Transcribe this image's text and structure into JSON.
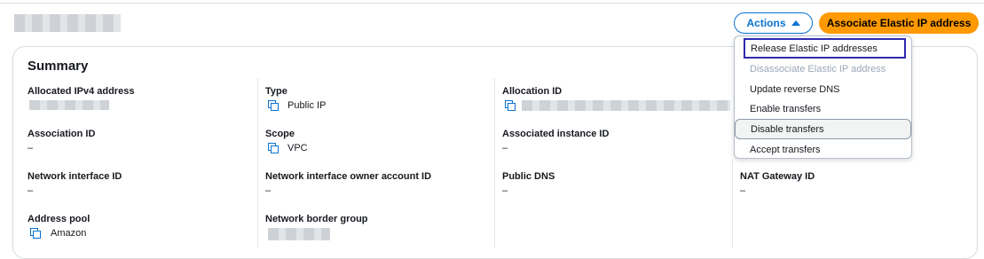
{
  "header": {
    "actions_label": "Actions",
    "associate_label": "Associate Elastic IP address"
  },
  "summary": {
    "title": "Summary",
    "fields": {
      "allocated_ipv4_label": "Allocated IPv4 address",
      "type_label": "Type",
      "type_value": "Public IP",
      "allocation_id_label": "Allocation ID",
      "association_id_label": "Association ID",
      "association_id_value": "–",
      "scope_label": "Scope",
      "scope_value": "VPC",
      "associated_instance_label": "Associated instance ID",
      "associated_instance_value": "–",
      "network_interface_label": "Network interface ID",
      "network_interface_value": "–",
      "ni_owner_label": "Network interface owner account ID",
      "ni_owner_value": "–",
      "public_dns_label": "Public DNS",
      "public_dns_value": "–",
      "nat_gateway_label": "NAT Gateway ID",
      "nat_gateway_value": "–",
      "address_pool_label": "Address pool",
      "address_pool_value": "Amazon",
      "border_group_label": "Network border group"
    }
  },
  "actions_menu": {
    "items": [
      "Release Elastic IP addresses",
      "Disassociate Elastic IP address",
      "Update reverse DNS",
      "Enable transfers",
      "Disable transfers",
      "Accept transfers"
    ]
  },
  "colors": {
    "accent": "#0972d3",
    "primary": "#ff9900",
    "focus": "#2f2ab0"
  }
}
